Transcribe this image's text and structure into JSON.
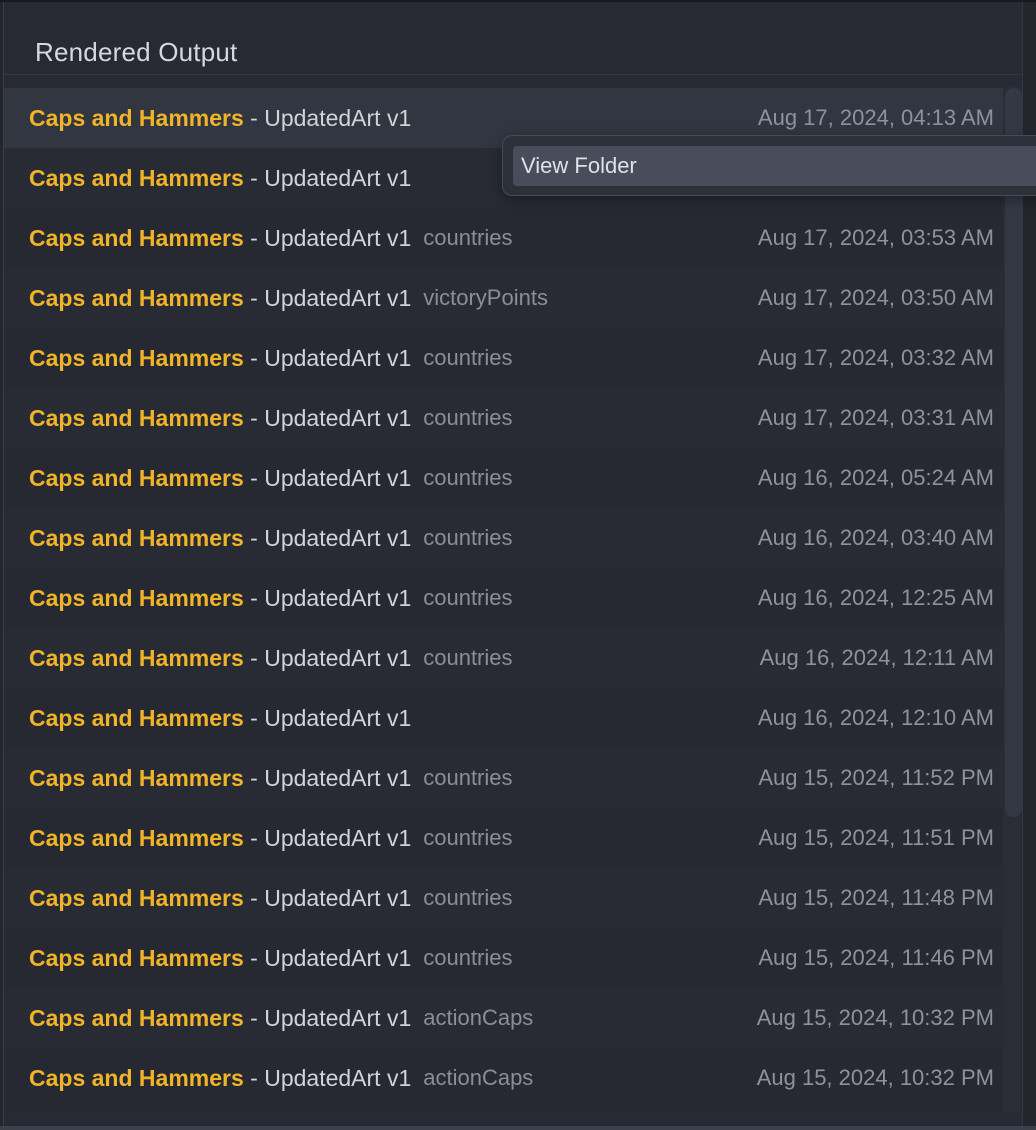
{
  "panel": {
    "title": "Rendered Output"
  },
  "colors": {
    "title_accent": "#f0b429",
    "background": "#272a33",
    "selected_row": "#313640"
  },
  "rows": [
    {
      "project": "Caps and Hammers",
      "sep": " - ",
      "version": "UpdatedArt v1",
      "tag": "",
      "date": "Aug 17, 2024, 04:13 AM",
      "selected": true
    },
    {
      "project": "Caps and Hammers",
      "sep": " - ",
      "version": "UpdatedArt v1",
      "tag": "",
      "date": "",
      "selected": false
    },
    {
      "project": "Caps and Hammers",
      "sep": " - ",
      "version": "UpdatedArt v1",
      "tag": "countries",
      "date": "Aug 17, 2024, 03:53 AM",
      "selected": false
    },
    {
      "project": "Caps and Hammers",
      "sep": " - ",
      "version": "UpdatedArt v1",
      "tag": "victoryPoints",
      "date": "Aug 17, 2024, 03:50 AM",
      "selected": false
    },
    {
      "project": "Caps and Hammers",
      "sep": " - ",
      "version": "UpdatedArt v1",
      "tag": "countries",
      "date": "Aug 17, 2024, 03:32 AM",
      "selected": false
    },
    {
      "project": "Caps and Hammers",
      "sep": " - ",
      "version": "UpdatedArt v1",
      "tag": "countries",
      "date": "Aug 17, 2024, 03:31 AM",
      "selected": false
    },
    {
      "project": "Caps and Hammers",
      "sep": " - ",
      "version": "UpdatedArt v1",
      "tag": "countries",
      "date": "Aug 16, 2024, 05:24 AM",
      "selected": false
    },
    {
      "project": "Caps and Hammers",
      "sep": " - ",
      "version": "UpdatedArt v1",
      "tag": "countries",
      "date": "Aug 16, 2024, 03:40 AM",
      "selected": false
    },
    {
      "project": "Caps and Hammers",
      "sep": " - ",
      "version": "UpdatedArt v1",
      "tag": "countries",
      "date": "Aug 16, 2024, 12:25 AM",
      "selected": false
    },
    {
      "project": "Caps and Hammers",
      "sep": " - ",
      "version": "UpdatedArt v1",
      "tag": "countries",
      "date": "Aug 16, 2024, 12:11 AM",
      "selected": false
    },
    {
      "project": "Caps and Hammers",
      "sep": " - ",
      "version": "UpdatedArt v1",
      "tag": "",
      "date": "Aug 16, 2024, 12:10 AM",
      "selected": false
    },
    {
      "project": "Caps and Hammers",
      "sep": " - ",
      "version": "UpdatedArt v1",
      "tag": "countries",
      "date": "Aug 15, 2024, 11:52 PM",
      "selected": false
    },
    {
      "project": "Caps and Hammers",
      "sep": " - ",
      "version": "UpdatedArt v1",
      "tag": "countries",
      "date": "Aug 15, 2024, 11:51 PM",
      "selected": false
    },
    {
      "project": "Caps and Hammers",
      "sep": " - ",
      "version": "UpdatedArt v1",
      "tag": "countries",
      "date": "Aug 15, 2024, 11:48 PM",
      "selected": false
    },
    {
      "project": "Caps and Hammers",
      "sep": " - ",
      "version": "UpdatedArt v1",
      "tag": "countries",
      "date": "Aug 15, 2024, 11:46 PM",
      "selected": false
    },
    {
      "project": "Caps and Hammers",
      "sep": " - ",
      "version": "UpdatedArt v1",
      "tag": "actionCaps",
      "date": "Aug 15, 2024, 10:32 PM",
      "selected": false
    },
    {
      "project": "Caps and Hammers",
      "sep": " - ",
      "version": "UpdatedArt v1",
      "tag": "actionCaps",
      "date": "Aug 15, 2024, 10:32 PM",
      "selected": false
    }
  ],
  "context_menu": {
    "items": [
      {
        "label": "View Folder",
        "highlighted": true
      }
    ]
  }
}
